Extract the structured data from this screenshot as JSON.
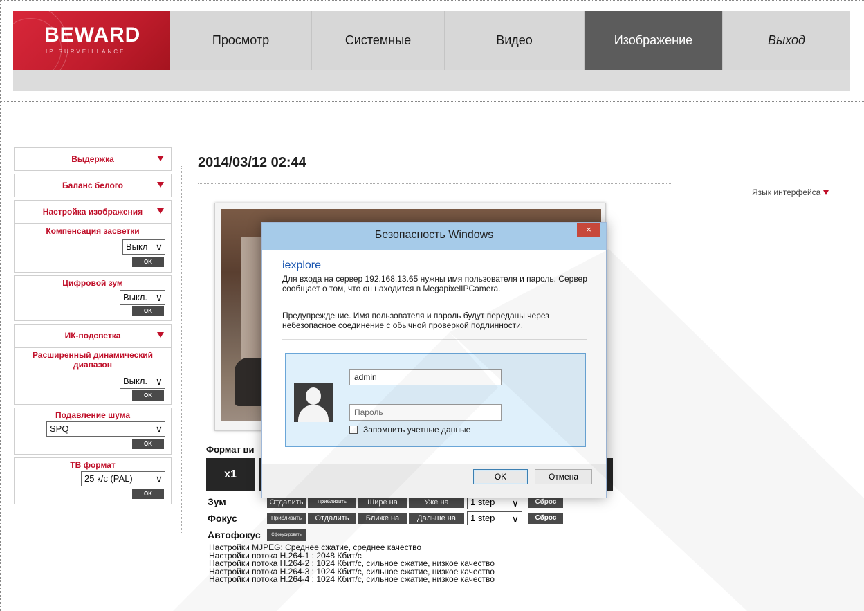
{
  "logo": {
    "brand": "BEWARD",
    "subtitle": "IP SURVEILLANCE"
  },
  "nav": [
    {
      "label": "Просмотр",
      "active": false
    },
    {
      "label": "Системные",
      "active": false
    },
    {
      "label": "Видео",
      "active": false
    },
    {
      "label": "Изображение",
      "active": true
    },
    {
      "label": "Выход",
      "active": false
    }
  ],
  "sidebar": {
    "exposure": "Выдержка",
    "white_balance": "Баланс белого",
    "image_settings": "Настройка изображения",
    "backlight": {
      "title": "Компенсация засветки",
      "value": "Выкл",
      "ok": "OK"
    },
    "digital_zoom": {
      "title": "Цифровой зум",
      "value": "Выкл.",
      "ok": "OK"
    },
    "ir": "ИК-подсветка",
    "wdr": {
      "title": "Расширенный динамический диапазон",
      "value": "Выкл.",
      "ok": "OK"
    },
    "noise": {
      "title": "Подавление шума",
      "value": "SPQ",
      "ok": "OK"
    },
    "tv": {
      "title": "ТВ формат",
      "value": "25 к/с (PAL)",
      "ok": "OK"
    }
  },
  "main": {
    "datetime": "2014/03/12 02:44",
    "language": "Язык интерфейса",
    "format_label": "Формат ви",
    "format_btn": "x1",
    "zoom": {
      "label": "Зум",
      "out": "Отдалить",
      "in": "Приблизить",
      "wide": "Шире на",
      "narrow": "Уже на",
      "step": "1 step",
      "reset": "Сброс"
    },
    "focus": {
      "label": "Фокус",
      "near": "Приблизить",
      "far": "Отдалить",
      "closer": "Ближе на",
      "further": "Дальше на",
      "step": "1 step",
      "reset": "Сброс"
    },
    "autofocus": {
      "label": "Автофокус",
      "btn": "Сфокусировать"
    },
    "info": [
      "Настройки MJPEG: Среднее сжатие, среднее качество",
      "Настройки потока H.264-1 : 2048 Кбит/с",
      "Настройки потока H.264-2 : 1024 Кбит/с, сильное сжатие, низкое качество",
      "Настройки потока H.264-3 : 1024 Кбит/с, сильное сжатие, низкое качество",
      "Настройки потока H.264-4 : 1024 Кбит/с, сильное сжатие, низкое качество"
    ]
  },
  "dialog": {
    "title": "Безопасность Windows",
    "close": "×",
    "app": "iexplore",
    "message": "Для входа на сервер 192.168.13.65 нужны имя пользователя и пароль. Сервер сообщает о том, что он находится в MegapixelIPCamera.",
    "warning": "Предупреждение. Имя пользователя и пароль будут переданы через небезопасное соединение с обычной проверкой подлинности.",
    "username": "admin",
    "password_placeholder": "Пароль",
    "remember": "Запомнить учетные данные",
    "ok": "OK",
    "cancel": "Отмена"
  }
}
